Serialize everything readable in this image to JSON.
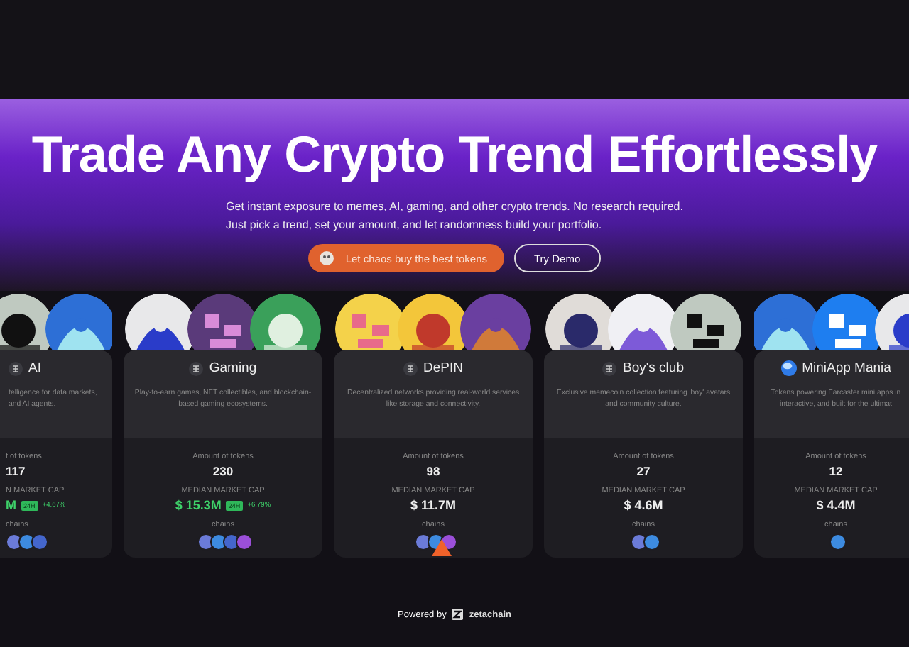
{
  "hero": {
    "title": "Trade Any Crypto Trend Effortlessly",
    "subtitle_lines": [
      "Get instant exposure to memes, AI, gaming, and other crypto trends. No research required.",
      "Just pick a trend, set your amount, and let randomness build your portfolio."
    ],
    "primary_button": "Let chaos buy the best tokens",
    "secondary_button": "Try Demo"
  },
  "cards": [
    {
      "kind": "cut_left",
      "title": "AI",
      "description": "telligence for data markets, and AI agents.",
      "tokens_label": "t of tokens",
      "tokens": "117",
      "cap_label": "N MARKET CAP",
      "cap": "M",
      "badge": "24H",
      "change": "+4.67%",
      "chains_label": "chains",
      "avatars": [
        {
          "kind": "picture"
        },
        {
          "kind": "picture"
        }
      ],
      "chains": [
        {
          "color": "#6b7bd8"
        },
        {
          "color": "#3d8be0"
        },
        {
          "color": "#4466cc"
        }
      ]
    },
    {
      "kind": "full",
      "title": "Gaming",
      "description": "Play-to-earn games, NFT collectibles, and blockchain-based gaming ecosystems.",
      "tokens_label": "Amount of tokens",
      "tokens": "230",
      "cap_label": "MEDIAN MARKET CAP",
      "cap": "$ 15.3M",
      "badge": "24H",
      "change": "+6.79%",
      "chains_label": "chains",
      "avatars": [
        {
          "kind": "picture"
        },
        {
          "kind": "picture"
        },
        {
          "kind": "picture"
        }
      ],
      "chains": [
        {
          "color": "#6b7bd8"
        },
        {
          "color": "#3d8be0"
        },
        {
          "color": "#4466cc"
        },
        {
          "color": "#9b4fd9"
        }
      ]
    },
    {
      "kind": "full",
      "title": "DePIN",
      "description": "Decentralized networks providing real-world services like storage and connectivity.",
      "tokens_label": "Amount of tokens",
      "tokens": "98",
      "cap_label": "MEDIAN MARKET CAP",
      "cap": "$ 11.7M",
      "chains_label": "chains",
      "avatars": [
        {
          "kind": "picture"
        },
        {
          "kind": "picture"
        },
        {
          "kind": "picture"
        }
      ],
      "chains": [
        {
          "color": "#6b7bd8"
        },
        {
          "color": "#3d8be0"
        },
        {
          "color": "#9b4fd9"
        }
      ]
    },
    {
      "kind": "full",
      "title": "Boy's club",
      "description": "Exclusive memecoin collection featuring 'boy' avatars and community culture.",
      "tokens_label": "Amount of tokens",
      "tokens": "27",
      "cap_label": "MEDIAN MARKET CAP",
      "cap": "$ 4.6M",
      "chains_label": "chains",
      "avatars": [
        {
          "kind": "picture"
        },
        {
          "kind": "picture"
        },
        {
          "kind": "picture"
        }
      ],
      "chains": [
        {
          "color": "#6b7bd8"
        },
        {
          "color": "#3d8be0"
        }
      ]
    },
    {
      "kind": "cut_right",
      "title": "MiniApp Mania",
      "description": "Tokens powering Farcaster mini apps in interactive, and built for the ultimat",
      "tokens_label": "Amount of tokens",
      "tokens": "12",
      "cap_label": "MEDIAN MARKET CAP",
      "cap": "$ 4.4M",
      "chains_label": "chains",
      "avatars": [
        {
          "kind": "picture"
        },
        {
          "kind": "picture"
        },
        {
          "kind": "picture"
        }
      ],
      "chains": [
        {
          "color": "#3d8be0"
        }
      ]
    }
  ],
  "footer": {
    "label": "Powered by",
    "brand": "zetachain"
  }
}
